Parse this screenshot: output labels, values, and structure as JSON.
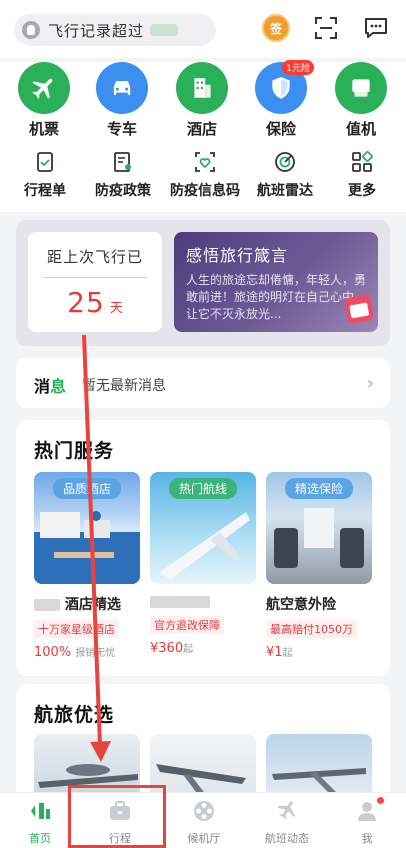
{
  "colors": {
    "accent": "#2bb05a",
    "alert": "#e23c3c",
    "annotation": "#e8443f"
  },
  "topbar": {
    "search_text": "飞行记录超过",
    "checkin_label": "签",
    "scan_icon": "scan-icon",
    "message_icon": "message-icon"
  },
  "main_services": [
    {
      "label": "机票",
      "icon": "airplane-icon"
    },
    {
      "label": "专车",
      "icon": "car-icon"
    },
    {
      "label": "酒店",
      "icon": "hotel-icon"
    },
    {
      "label": "保险",
      "icon": "shield-icon",
      "badge": "1元险"
    },
    {
      "label": "值机",
      "icon": "seat-icon"
    }
  ],
  "secondary_services": [
    {
      "label": "行程单",
      "icon": "itinerary-icon"
    },
    {
      "label": "防疫政策",
      "icon": "policy-icon"
    },
    {
      "label": "防疫信息码",
      "icon": "health-code-icon"
    },
    {
      "label": "航班雷达",
      "icon": "radar-icon"
    },
    {
      "label": "更多",
      "icon": "more-grid-icon"
    }
  ],
  "flight_card": {
    "since_label": "距上次飞行已",
    "days_value": "25",
    "days_unit": "天",
    "quote_title": "感悟旅行箴言",
    "quote_text": "人生的旅途忘却倦慵，年轻人，勇敢前进！旅途的明灯在自己心中，让它不灭永放光..."
  },
  "messages": {
    "label_a": "消",
    "label_b": "息",
    "text": "暂无最新消息"
  },
  "hot_services": {
    "title": "热门服务",
    "items": [
      {
        "tag": "品质酒店",
        "name": "酒店精选",
        "sub": "十万家星级酒店",
        "price": "100%",
        "price_note": "报销无忧"
      },
      {
        "tag": "热门航线",
        "name": "",
        "sub": "官方退改保障",
        "price": "¥360",
        "price_note": "起"
      },
      {
        "tag": "精选保险",
        "name": "航空意外险",
        "sub": "最高赔付1050万",
        "price": "¥1",
        "price_note": "起"
      }
    ]
  },
  "travel_picks": {
    "title": "航旅优选"
  },
  "bottom_nav": [
    {
      "label": "首页",
      "icon": "home-icon",
      "active": true
    },
    {
      "label": "行程",
      "icon": "briefcase-icon",
      "active": false
    },
    {
      "label": "候机厅",
      "icon": "film-reel-icon",
      "active": false
    },
    {
      "label": "航班动态",
      "icon": "flight-status-icon",
      "active": false
    },
    {
      "label": "我",
      "icon": "profile-icon",
      "active": false
    }
  ]
}
